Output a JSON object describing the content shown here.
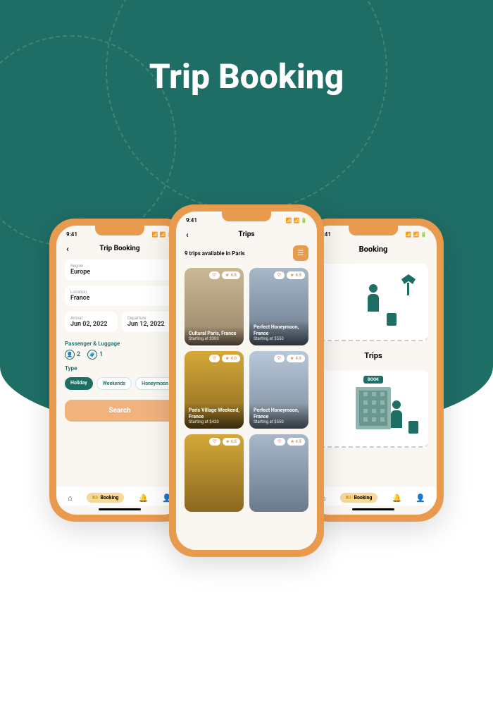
{
  "hero_title": "Trip Booking",
  "status_time": "9:41",
  "phone1": {
    "title": "Trip Booking",
    "region_label": "Region",
    "region_value": "Europe",
    "location_label": "Location",
    "location_value": "France",
    "arrival_label": "Arrival",
    "arrival_value": "Jun 02, 2022",
    "departure_label": "Departure",
    "departure_value": "Jun 12, 2022",
    "passenger_label": "Passenger & Luggage",
    "passengers": "2",
    "luggage": "1",
    "type_label": "Type",
    "chips": [
      "Holiday",
      "Weekends",
      "Honeymoon tri"
    ],
    "search": "Search"
  },
  "phone2": {
    "title": "Trips",
    "count": "9 trips available in Paris",
    "cards": [
      {
        "name": "Cultural Paris, France",
        "price": "Starting at $300",
        "rating": "4.5"
      },
      {
        "name": "Perfect Honeymoon, France",
        "price": "Starting at $550",
        "rating": "4.5"
      },
      {
        "name": "Paris Village Weekend, France",
        "price": "Starting at $420",
        "rating": "4.0"
      },
      {
        "name": "Perfect Honeymoon, France",
        "price": "Starting at $550",
        "rating": "4.5"
      }
    ]
  },
  "phone3": {
    "booking_title": "Booking",
    "trips_title": "Trips",
    "book_tag": "BOOK"
  },
  "nav": {
    "booking": "Booking"
  }
}
